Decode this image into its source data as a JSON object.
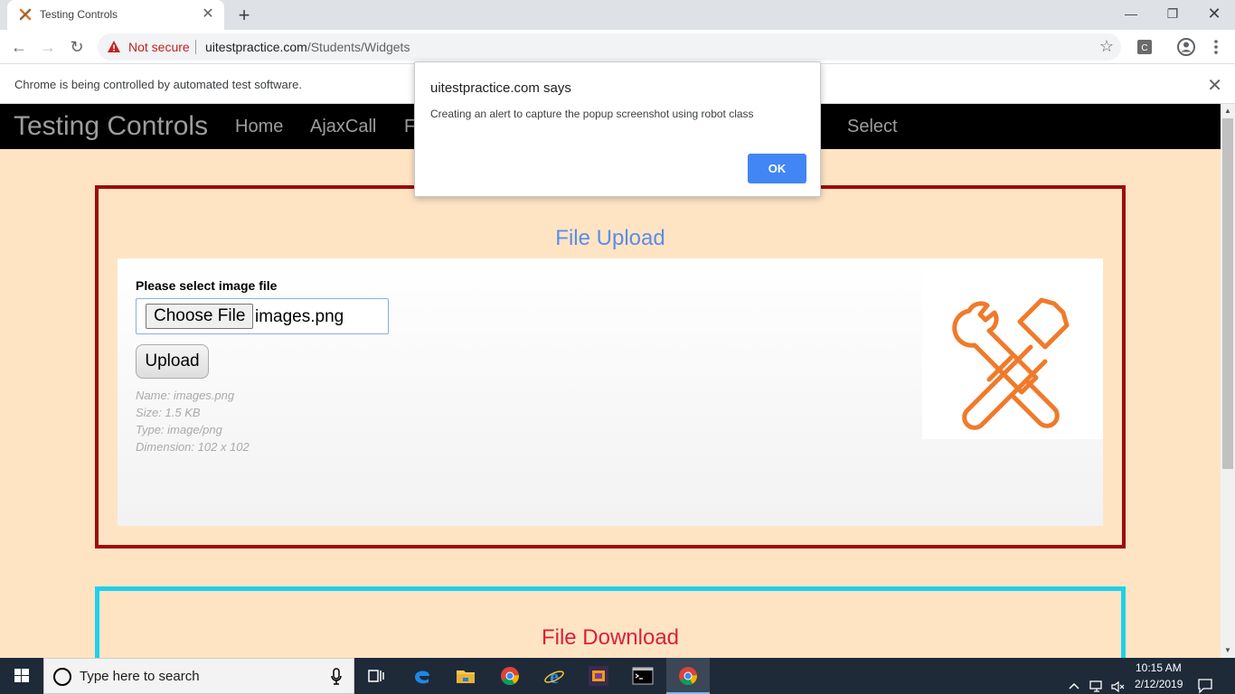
{
  "browser": {
    "tab_title": "Testing Controls",
    "security_label": "Not secure",
    "url_host": "uitestpractice.com",
    "url_path": "/Students/Widgets",
    "infobar_text": "Chrome is being controlled by automated test software."
  },
  "site": {
    "brand": "Testing Controls",
    "nav": [
      "Home",
      "AjaxCall",
      "F",
      "Select"
    ]
  },
  "upload": {
    "title": "File Upload",
    "title_color": "#5b8ee6",
    "label": "Please select image file",
    "choose_button": "Choose File",
    "file_name": "images.png",
    "upload_button": "Upload",
    "meta_name": "Name: images.png",
    "meta_size": "Size: 1.5 KB",
    "meta_type": "Type: image/png",
    "meta_dimension": "Dimension: 102 x 102",
    "preview_icon": "hammer-wrench-icon"
  },
  "download": {
    "title": "File Download",
    "title_color": "#dc1f3a"
  },
  "alert": {
    "title": "uitestpractice.com says",
    "message": "Creating an alert to capture the popup screenshot using robot class",
    "ok_button": "OK"
  },
  "taskbar": {
    "search_placeholder": "Type here to search",
    "time": "10:15 AM",
    "date": "2/12/2019"
  },
  "colors": {
    "page_bg": "#ffe4c4",
    "upload_border": "#a00a0a",
    "download_border": "#1fd0ec",
    "alert_ok": "#4285f4"
  }
}
